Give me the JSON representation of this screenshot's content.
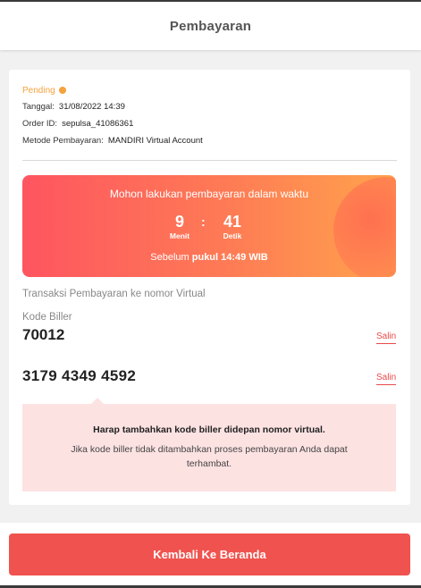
{
  "header": {
    "title": "Pembayaran"
  },
  "order": {
    "status": "Pending",
    "date_label": "Tanggal:",
    "date_value": "31/08/2022 14:39",
    "order_label": "Order ID:",
    "order_value": "sepulsa_41086361",
    "method_label": "Metode Pembayaran:",
    "method_value": "MANDIRI Virtual Account"
  },
  "timer": {
    "title": "Mohon lakukan pembayaran dalam waktu",
    "minutes": "9",
    "minutes_label": "Menit",
    "separator": ":",
    "seconds": "41",
    "seconds_label": "Detik",
    "before_prefix": "Sebelum",
    "before_time": "pukul 14:49 WIB"
  },
  "virtual": {
    "title": "Transaksi Pembayaran ke nomor Virtual",
    "biller_label": "Kode Biller",
    "biller_value": "70012",
    "copy_label": "Salin",
    "va_number": "3179 4349 4592"
  },
  "note": {
    "title": "Harap tambahkan kode biller didepan nomor virtual.",
    "body": "Jika kode biller tidak ditambahkan proses pembayaran Anda dapat terhambat."
  },
  "footer": {
    "button_label": "Kembali Ke Beranda"
  },
  "colors": {
    "accent": "#f0534f",
    "pending": "#f6a23c",
    "timer_start": "#fe5560",
    "timer_end": "#ffa44c",
    "note_bg": "#fde2e2"
  }
}
